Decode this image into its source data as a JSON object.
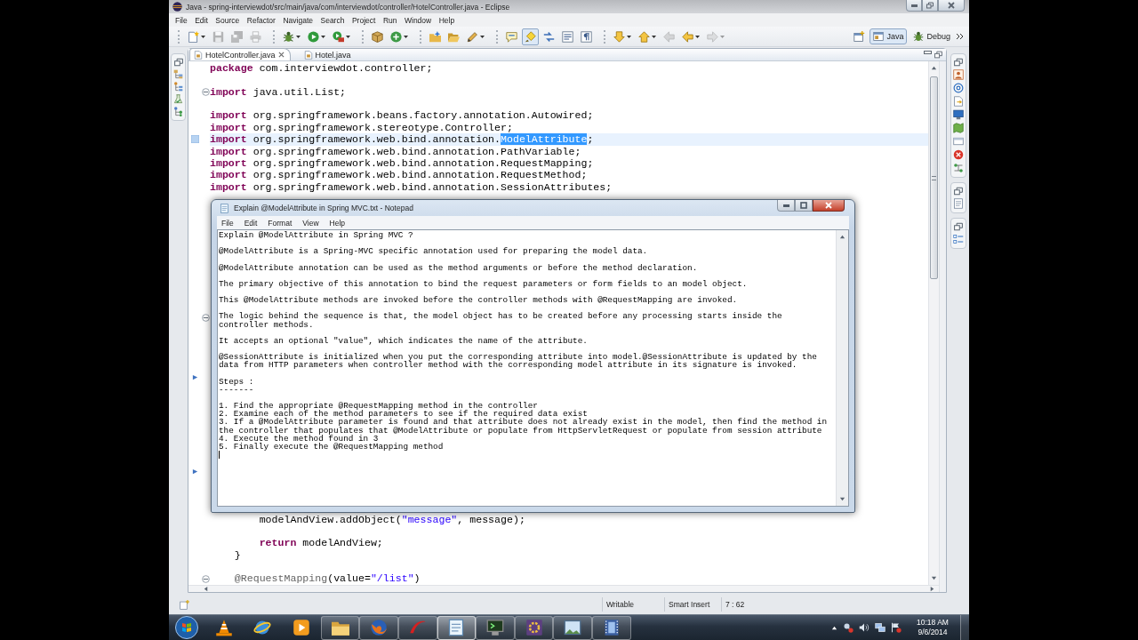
{
  "window": {
    "title": "Java - spring-interviewdot/src/main/java/com/interviewdot/controller/HotelController.java - Eclipse"
  },
  "menu": [
    "File",
    "Edit",
    "Source",
    "Refactor",
    "Navigate",
    "Search",
    "Project",
    "Run",
    "Window",
    "Help"
  ],
  "toolbar": [
    [
      {
        "kind": "new",
        "menu": true,
        "disabled": false,
        "pressed": false
      },
      {
        "kind": "save",
        "menu": false,
        "disabled": true,
        "pressed": false
      },
      {
        "kind": "save_all",
        "menu": false,
        "disabled": true,
        "pressed": false
      },
      {
        "kind": "print",
        "menu": false,
        "disabled": true,
        "pressed": false
      }
    ],
    [
      {
        "kind": "bug",
        "menu": true,
        "disabled": false,
        "pressed": false
      },
      {
        "kind": "run",
        "menu": true,
        "disabled": false,
        "pressed": false
      },
      {
        "kind": "tool",
        "menu": true,
        "disabled": false,
        "pressed": false
      }
    ],
    [
      {
        "kind": "package",
        "menu": false,
        "disabled": false,
        "pressed": false
      },
      {
        "kind": "class",
        "menu": true,
        "disabled": false,
        "pressed": false
      }
    ],
    [
      {
        "kind": "open_type",
        "menu": false,
        "disabled": false,
        "pressed": false
      },
      {
        "kind": "folder",
        "menu": false,
        "disabled": false,
        "pressed": false
      },
      {
        "kind": "pencil",
        "menu": true,
        "disabled": false,
        "pressed": false
      }
    ],
    [
      {
        "kind": "annotation",
        "menu": false,
        "disabled": false,
        "pressed": false
      },
      {
        "kind": "highlight",
        "menu": false,
        "disabled": false,
        "pressed": true
      },
      {
        "kind": "arrows",
        "menu": false,
        "disabled": false,
        "pressed": false
      },
      {
        "kind": "block",
        "menu": false,
        "disabled": false,
        "pressed": false
      },
      {
        "kind": "pilcrow",
        "menu": false,
        "disabled": false,
        "pressed": false
      }
    ],
    [
      {
        "kind": "next",
        "menu": true,
        "disabled": false,
        "pressed": false
      },
      {
        "kind": "prev",
        "menu": true,
        "disabled": false,
        "pressed": false
      },
      {
        "kind": "back_edit",
        "menu": false,
        "disabled": true,
        "pressed": false
      },
      {
        "kind": "back",
        "menu": true,
        "disabled": false,
        "pressed": false
      },
      {
        "kind": "forward",
        "menu": true,
        "disabled": true,
        "pressed": false
      }
    ]
  ],
  "perspectives": [
    {
      "label": "Java",
      "selected": true
    },
    {
      "label": "Debug",
      "selected": false
    }
  ],
  "editor": {
    "tabs": [
      {
        "label": "HotelController.java",
        "selected": true
      },
      {
        "label": "Hotel.java",
        "selected": false
      }
    ],
    "top_blocks": [
      [
        {
          "current": false,
          "tokens": [
            {
              "kind": "keyword",
              "text": "package"
            },
            {
              "kind": "plain",
              "text": " com.interviewdot.controller;"
            }
          ]
        }
      ],
      [
        {
          "current": false,
          "folded": false,
          "tokens": [
            {
              "kind": "keyword",
              "text": "import"
            },
            {
              "kind": "plain",
              "text": " java.util.List;"
            }
          ]
        }
      ],
      [
        {
          "current": false,
          "tokens": [
            {
              "kind": "keyword",
              "text": "import"
            },
            {
              "kind": "plain",
              "text": " org.springframework.beans.factory.annotation.Autowired;"
            }
          ]
        },
        {
          "current": false,
          "tokens": [
            {
              "kind": "keyword",
              "text": "import"
            },
            {
              "kind": "plain",
              "text": " org.springframework.stereotype.Controller;"
            }
          ]
        },
        {
          "current": true,
          "tokens": [
            {
              "kind": "keyword",
              "text": "import"
            },
            {
              "kind": "plain",
              "text": " org.springframework.web.bind.annotation."
            },
            {
              "kind": "selection",
              "text": "ModelAttribute"
            },
            {
              "kind": "plain",
              "text": ";"
            }
          ]
        },
        {
          "current": false,
          "tokens": [
            {
              "kind": "keyword",
              "text": "import"
            },
            {
              "kind": "plain",
              "text": " org.springframework.web.bind.annotation.PathVariable;"
            }
          ]
        },
        {
          "current": false,
          "tokens": [
            {
              "kind": "keyword",
              "text": "import"
            },
            {
              "kind": "plain",
              "text": " org.springframework.web.bind.annotation.RequestMapping;"
            }
          ]
        },
        {
          "current": false,
          "tokens": [
            {
              "kind": "keyword",
              "text": "import"
            },
            {
              "kind": "plain",
              "text": " org.springframework.web.bind.annotation.RequestMethod;"
            }
          ]
        },
        {
          "current": false,
          "tokens": [
            {
              "kind": "keyword",
              "text": "import"
            },
            {
              "kind": "plain",
              "text": " org.springframework.web.bind.annotation.SessionAttributes;"
            }
          ]
        }
      ]
    ],
    "bottom_blocks": [
      [
        {
          "current": false,
          "tokens": [
            {
              "kind": "plain",
              "text": "        modelAndView.addObject("
            },
            {
              "kind": "string",
              "text": "\"message\""
            },
            {
              "kind": "plain",
              "text": ", message);"
            }
          ]
        }
      ],
      [
        {
          "current": false,
          "tokens": [
            {
              "kind": "keyword",
              "text": "        return"
            },
            {
              "kind": "plain",
              "text": " modelAndView;"
            }
          ]
        },
        {
          "current": false,
          "tokens": [
            {
              "kind": "plain",
              "text": "    }"
            }
          ]
        }
      ],
      [
        {
          "current": false,
          "folded": false,
          "tokens": [
            {
              "kind": "annotation",
              "text": "    @RequestMapping"
            },
            {
              "kind": "plain",
              "text": "(value="
            },
            {
              "kind": "string",
              "text": "\"/list\""
            },
            {
              "kind": "plain",
              "text": ")"
            }
          ]
        }
      ]
    ]
  },
  "notepad": {
    "title": "Explain @ModelAttribute in Spring MVC.txt - Notepad",
    "menu": [
      "File",
      "Edit",
      "Format",
      "View",
      "Help"
    ],
    "paragraphs": [
      "Explain @ModelAttribute in Spring MVC ?",
      "@ModelAttribute is a Spring-MVC specific annotation used for preparing the model data.",
      "@ModelAttribute annotation can be used as the method arguments or before the method declaration.",
      "The primary objective of this annotation to bind the request parameters or form fields to an model object.",
      "This @ModelAttribute methods are invoked before the controller methods with @RequestMapping are invoked.",
      "The logic behind the sequence is that, the model object has to be created before any processing starts inside the controller methods.",
      "It accepts an optional \"value\", which indicates the name of the attribute.",
      "@SessionAttribute is initialized when you put the corresponding attribute into model.@SessionAttribute is updated by the data from HTTP parameters when controller method with the corresponding model attribute in its signature is invoked."
    ],
    "steps_heading": "Steps :",
    "steps_rule": "-------",
    "steps": [
      "1. Find the appropriate @RequestMapping method in the controller",
      "2. Examine each of the method parameters to see if the required data exist",
      "3. If a @ModelAttribute parameter is found and that attribute does not already exist in the model, then find the method in the controller that populates that @ModelAttribute or populate from HttpServletRequest or populate from session attribute",
      "4. Execute the method found in 3",
      "5. Finally execute the @RequestMapping method"
    ]
  },
  "status_bar": {
    "fields": [
      "Writable",
      "Smart Insert",
      "7 : 62"
    ]
  },
  "taskbar": {
    "apps": [
      {
        "kind": "cone",
        "running": false,
        "selected": false
      },
      {
        "kind": "globe",
        "running": false,
        "selected": false
      },
      {
        "kind": "player",
        "running": false,
        "selected": false
      },
      {
        "kind": "folder",
        "running": true,
        "selected": false
      },
      {
        "kind": "fox",
        "running": true,
        "selected": false
      },
      {
        "kind": "swoosh",
        "running": true,
        "selected": false
      },
      {
        "kind": "notepad",
        "running": true,
        "selected": true
      },
      {
        "kind": "terminal",
        "running": true,
        "selected": false
      },
      {
        "kind": "ide",
        "running": true,
        "selected": false
      },
      {
        "kind": "picture",
        "running": true,
        "selected": false
      },
      {
        "kind": "film",
        "running": true,
        "selected": false
      }
    ],
    "time": "10:18 AM",
    "date": "9/6/2014"
  }
}
